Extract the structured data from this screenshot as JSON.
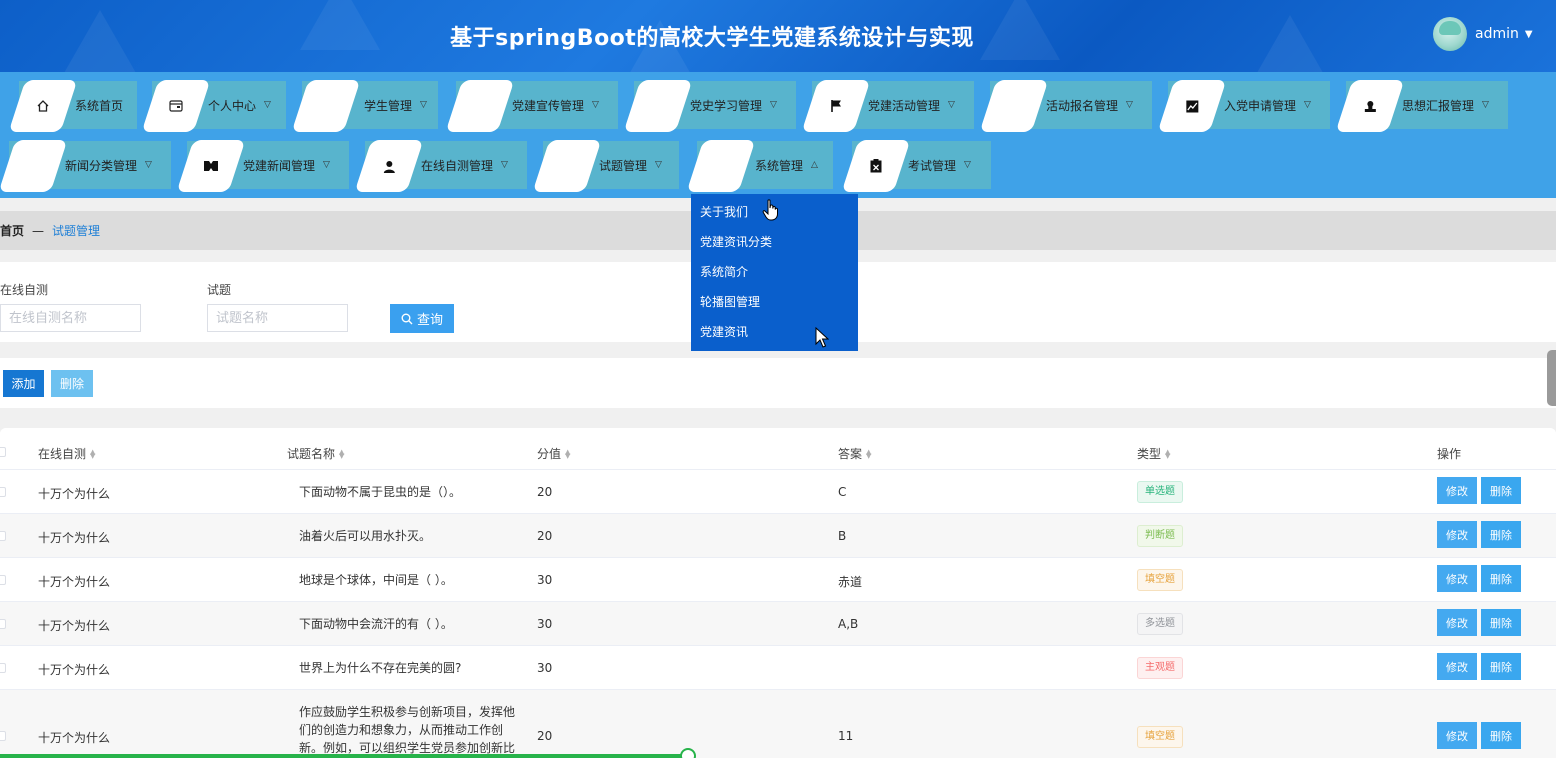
{
  "header": {
    "title": "基于springBoot的高校大学生党建系统设计与实现",
    "username": "admin"
  },
  "nav": {
    "items": [
      {
        "label": "系统首页",
        "icon": "home-icon"
      },
      {
        "label": "个人中心",
        "icon": "wallet-icon"
      },
      {
        "label": "学生管理",
        "icon": "grid-icon"
      },
      {
        "label": "党建宣传管理",
        "icon": "grid-icon"
      },
      {
        "label": "党史学习管理",
        "icon": "grid-icon"
      },
      {
        "label": "党建活动管理",
        "icon": "flag-icon"
      },
      {
        "label": "活动报名管理",
        "icon": "grid-icon"
      },
      {
        "label": "入党申请管理",
        "icon": "chart-icon"
      },
      {
        "label": "思想汇报管理",
        "icon": "stamp-icon"
      },
      {
        "label": "新闻分类管理",
        "icon": "grid-icon"
      },
      {
        "label": "党建新闻管理",
        "icon": "ticket-icon"
      },
      {
        "label": "在线自测管理",
        "icon": "user-icon"
      },
      {
        "label": "试题管理",
        "icon": "grid-icon"
      },
      {
        "label": "系统管理",
        "icon": "grid-icon"
      },
      {
        "label": "考试管理",
        "icon": "clipboard-icon"
      }
    ]
  },
  "dropdown": {
    "items": [
      "关于我们",
      "党建资讯分类",
      "系统简介",
      "轮播图管理",
      "党建资讯"
    ]
  },
  "breadcrumb": {
    "home": "首页",
    "sep": "—",
    "current": "试题管理"
  },
  "search": {
    "label1": "在线自测",
    "placeholder1": "在线自测名称",
    "label2": "试题",
    "placeholder2": "试题名称",
    "query_label": "查询"
  },
  "actions": {
    "add_label": "添加",
    "delete_label": "删除"
  },
  "table": {
    "headers": [
      "在线自测",
      "试题名称",
      "分值",
      "答案",
      "类型",
      "操作"
    ],
    "edit_label": "修改",
    "delete_label": "删除",
    "rows": [
      {
        "test": "十万个为什么",
        "question": "下面动物不属于昆虫的是（）。",
        "score": "20",
        "answer": "C",
        "type": "单选题",
        "kind": "single"
      },
      {
        "test": "十万个为什么",
        "question": "油着火后可以用水扑灭。",
        "score": "20",
        "answer": "B",
        "type": "判断题",
        "kind": "judge"
      },
      {
        "test": "十万个为什么",
        "question": "地球是个球体，中间是（ ）。",
        "score": "30",
        "answer": "赤道",
        "type": "填空题",
        "kind": "fill"
      },
      {
        "test": "十万个为什么",
        "question": "下面动物中会流汗的有（ ）。",
        "score": "30",
        "answer": "A,B",
        "type": "多选题",
        "kind": "multi"
      },
      {
        "test": "十万个为什么",
        "question": "世界上为什么不存在完美的圆?",
        "score": "30",
        "answer": "",
        "type": "主观题",
        "kind": "subj"
      },
      {
        "test": "十万个为什么",
        "question": "作应鼓励学生积极参与创新项目，发挥他们的创造力和想象力，从而推动工作创新。例如，可以组织学生党员参加创新比",
        "score": "20",
        "answer": "11",
        "type": "填空题",
        "kind": "fill"
      }
    ]
  }
}
